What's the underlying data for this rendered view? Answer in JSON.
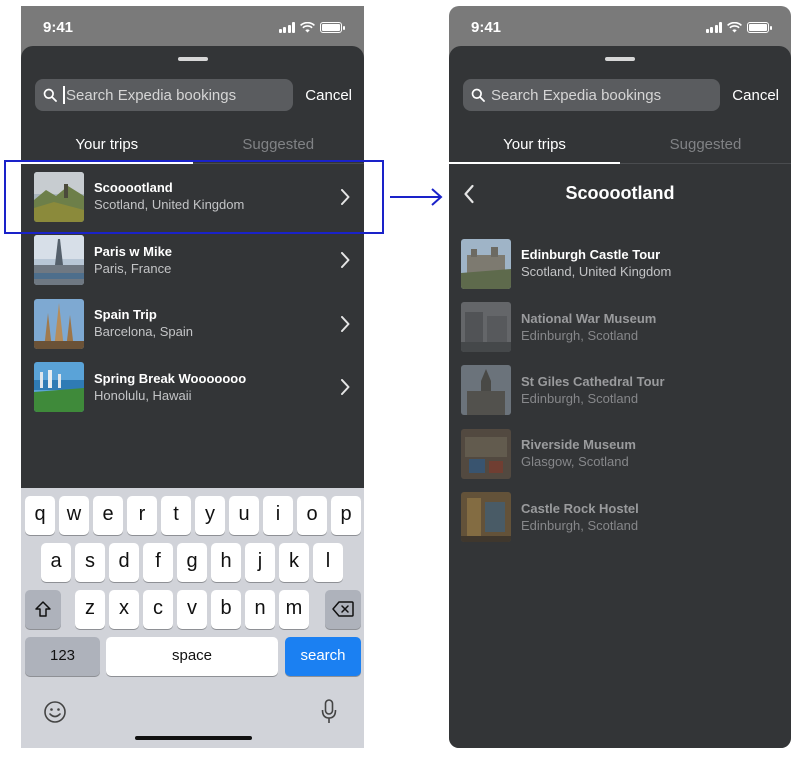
{
  "status_time": "9:41",
  "search": {
    "placeholder": "Search Expedia bookings",
    "value": ""
  },
  "cancel_label": "Cancel",
  "tabs": [
    "Your trips",
    "Suggested"
  ],
  "trips": [
    {
      "title": "Scooootland",
      "subtitle": "Scotland, United Kingdom"
    },
    {
      "title": "Paris w Mike",
      "subtitle": "Paris, France"
    },
    {
      "title": "Spain Trip",
      "subtitle": "Barcelona, Spain"
    },
    {
      "title": "Spring Break Wooooooo",
      "subtitle": "Honolulu, Hawaii"
    }
  ],
  "detail": {
    "title": "Scooootland",
    "bookings": [
      {
        "title": "Edinburgh Castle Tour",
        "subtitle": "Scotland, United Kingdom"
      },
      {
        "title": "National War Museum",
        "subtitle": "Edinburgh, Scotland"
      },
      {
        "title": "St Giles Cathedral Tour",
        "subtitle": "Edinburgh, Scotland"
      },
      {
        "title": "Riverside Museum",
        "subtitle": "Glasgow, Scotland"
      },
      {
        "title": "Castle Rock Hostel",
        "subtitle": "Edinburgh, Scotland"
      }
    ]
  },
  "keyboard": {
    "row1": [
      "q",
      "w",
      "e",
      "r",
      "t",
      "y",
      "u",
      "i",
      "o",
      "p"
    ],
    "row2": [
      "a",
      "s",
      "d",
      "f",
      "g",
      "h",
      "j",
      "k",
      "l"
    ],
    "row3": [
      "z",
      "x",
      "c",
      "v",
      "b",
      "n",
      "m"
    ],
    "numbers_label": "123",
    "space_label": "space",
    "search_label": "search"
  },
  "colors": {
    "sheet": "#333537",
    "highlight": "#1a22c9",
    "search_key": "#1b80f2"
  },
  "icons": [
    "search-icon",
    "chevron-right-icon",
    "back-chevron-icon",
    "shift-icon",
    "delete-icon",
    "emoji-icon",
    "microphone-icon",
    "arrow-right-icon"
  ]
}
